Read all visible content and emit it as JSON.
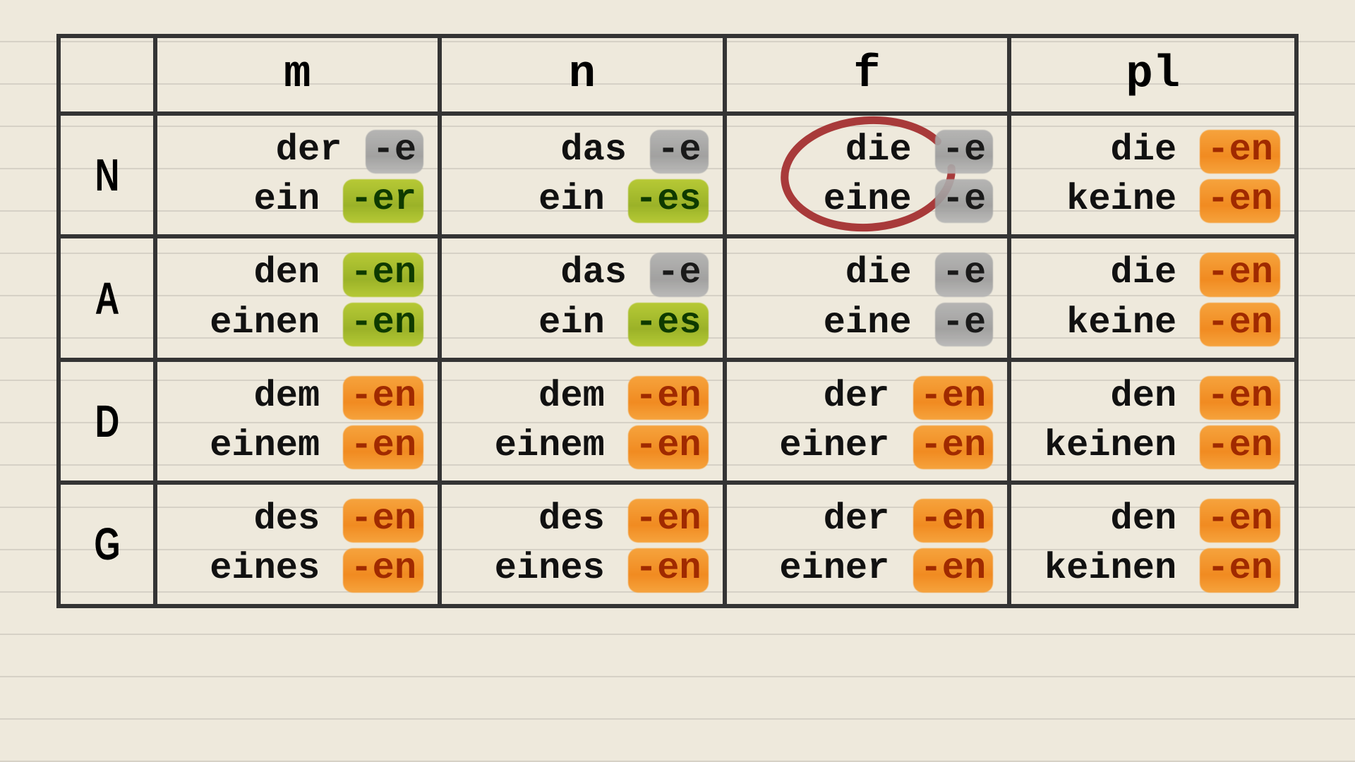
{
  "columns": [
    "m",
    "n",
    "f",
    "pl"
  ],
  "rows": [
    "N",
    "A",
    "D",
    "G"
  ],
  "highlight_colors": {
    "gray": "#9a9a9a",
    "olive": "#97b01f",
    "orange": "#f28a1e"
  },
  "annotation_circle": {
    "row": "N",
    "col": "f",
    "color": "#a83a3a"
  },
  "cells": {
    "N": {
      "m": [
        {
          "article": "der",
          "ending": "-e",
          "hl": "gray"
        },
        {
          "article": "ein",
          "ending": "-er",
          "hl": "olive"
        }
      ],
      "n": [
        {
          "article": "das",
          "ending": "-e",
          "hl": "gray"
        },
        {
          "article": "ein",
          "ending": "-es",
          "hl": "olive"
        }
      ],
      "f": [
        {
          "article": "die",
          "ending": "-e",
          "hl": "gray"
        },
        {
          "article": "eine",
          "ending": "-e",
          "hl": "gray"
        }
      ],
      "pl": [
        {
          "article": "die",
          "ending": "-en",
          "hl": "orange"
        },
        {
          "article": "keine",
          "ending": "-en",
          "hl": "orange"
        }
      ]
    },
    "A": {
      "m": [
        {
          "article": "den",
          "ending": "-en",
          "hl": "olive"
        },
        {
          "article": "einen",
          "ending": "-en",
          "hl": "olive"
        }
      ],
      "n": [
        {
          "article": "das",
          "ending": "-e",
          "hl": "gray"
        },
        {
          "article": "ein",
          "ending": "-es",
          "hl": "olive"
        }
      ],
      "f": [
        {
          "article": "die",
          "ending": "-e",
          "hl": "gray"
        },
        {
          "article": "eine",
          "ending": "-e",
          "hl": "gray"
        }
      ],
      "pl": [
        {
          "article": "die",
          "ending": "-en",
          "hl": "orange"
        },
        {
          "article": "keine",
          "ending": "-en",
          "hl": "orange"
        }
      ]
    },
    "D": {
      "m": [
        {
          "article": "dem",
          "ending": "-en",
          "hl": "orange"
        },
        {
          "article": "einem",
          "ending": "-en",
          "hl": "orange"
        }
      ],
      "n": [
        {
          "article": "dem",
          "ending": "-en",
          "hl": "orange"
        },
        {
          "article": "einem",
          "ending": "-en",
          "hl": "orange"
        }
      ],
      "f": [
        {
          "article": "der",
          "ending": "-en",
          "hl": "orange"
        },
        {
          "article": "einer",
          "ending": "-en",
          "hl": "orange"
        }
      ],
      "pl": [
        {
          "article": "den",
          "ending": "-en",
          "hl": "orange"
        },
        {
          "article": "keinen",
          "ending": "-en",
          "hl": "orange"
        }
      ]
    },
    "G": {
      "m": [
        {
          "article": "des",
          "ending": "-en",
          "hl": "orange"
        },
        {
          "article": "eines",
          "ending": "-en",
          "hl": "orange"
        }
      ],
      "n": [
        {
          "article": "des",
          "ending": "-en",
          "hl": "orange"
        },
        {
          "article": "eines",
          "ending": "-en",
          "hl": "orange"
        }
      ],
      "f": [
        {
          "article": "der",
          "ending": "-en",
          "hl": "orange"
        },
        {
          "article": "einer",
          "ending": "-en",
          "hl": "orange"
        }
      ],
      "pl": [
        {
          "article": "den",
          "ending": "-en",
          "hl": "orange"
        },
        {
          "article": "keinen",
          "ending": "-en",
          "hl": "orange"
        }
      ]
    }
  }
}
